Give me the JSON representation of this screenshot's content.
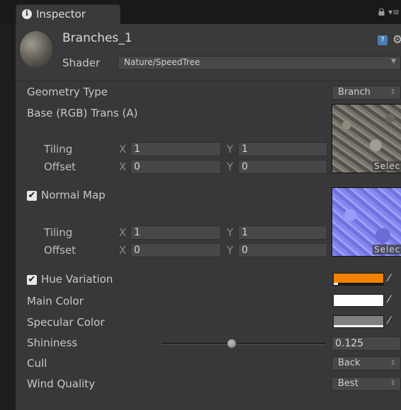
{
  "tab": {
    "title": "Inspector",
    "info_glyph": "i"
  },
  "header": {
    "material_name": "Branches_1",
    "shader_label": "Shader",
    "shader_value": "Nature/SpeedTree"
  },
  "properties": {
    "geometry_type": {
      "label": "Geometry Type",
      "value": "Branch"
    },
    "base_tex": {
      "label": "Base (RGB) Trans (A)",
      "tiling_label": "Tiling",
      "offset_label": "Offset",
      "x_axis": "X",
      "y_axis": "Y",
      "tiling_x": "1",
      "tiling_y": "1",
      "offset_x": "0",
      "offset_y": "0",
      "select_label": "Select"
    },
    "normal_map": {
      "label": "Normal Map",
      "checked": true,
      "tiling_label": "Tiling",
      "offset_label": "Offset",
      "x_axis": "X",
      "y_axis": "Y",
      "tiling_x": "1",
      "tiling_y": "1",
      "offset_x": "0",
      "offset_y": "0",
      "select_label": "Select"
    },
    "hue_variation": {
      "label": "Hue Variation",
      "checked": true,
      "color": "#f58205"
    },
    "main_color": {
      "label": "Main Color",
      "color": "#ffffff"
    },
    "specular_color": {
      "label": "Specular Color",
      "color": "#808080"
    },
    "shininess": {
      "label": "Shininess",
      "value": "0.125",
      "level": 0.125
    },
    "cull": {
      "label": "Cull",
      "value": "Back"
    },
    "wind_quality": {
      "label": "Wind Quality",
      "value": "Best"
    }
  },
  "icons": [
    "info-icon",
    "lock-icon",
    "menu-icon",
    "help-icon",
    "gear-icon",
    "checkbox-check-icon",
    "eyedropper-icon"
  ],
  "colors": {
    "panel_bg": "#383838",
    "header_bg": "#3a3a3a",
    "window_bg": "#1e1e1e"
  }
}
